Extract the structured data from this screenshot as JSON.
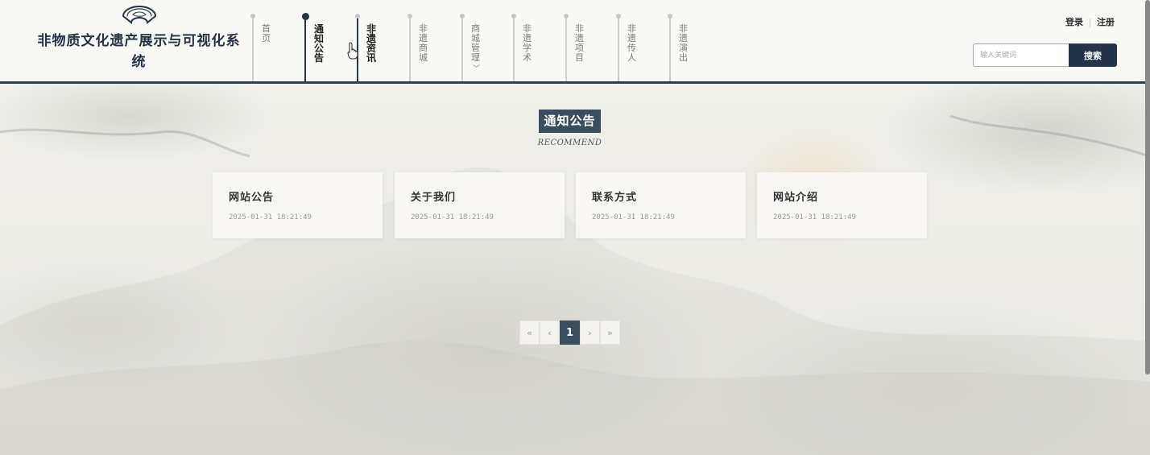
{
  "site": {
    "title": "非物质文化遗产展示与可视化系统"
  },
  "nav": {
    "items": [
      {
        "label": "首页"
      },
      {
        "label": "通知公告"
      },
      {
        "label": "非遗资讯"
      },
      {
        "label": "非遗商城"
      },
      {
        "label": "商城管理"
      },
      {
        "label": "非遗学术"
      },
      {
        "label": "非遗项目"
      },
      {
        "label": "非遗传人"
      },
      {
        "label": "非遗演出"
      }
    ],
    "active": "通知公告"
  },
  "auth": {
    "login": "登录",
    "register": "注册"
  },
  "search": {
    "placeholder": "输入关键词",
    "button": "搜索"
  },
  "section": {
    "title": "通知公告",
    "subtitle": "RECOMMEND"
  },
  "cards": [
    {
      "title": "网站公告",
      "date": "2025-01-31 18:21:49"
    },
    {
      "title": "关于我们",
      "date": "2025-01-31 18:21:49"
    },
    {
      "title": "联系方式",
      "date": "2025-01-31 18:21:49"
    },
    {
      "title": "网站介绍",
      "date": "2025-01-31 18:21:49"
    }
  ],
  "pagination": {
    "first": "«",
    "prev": "‹",
    "current": "1",
    "next": "›",
    "last": "»"
  },
  "colors": {
    "primary": "#253448",
    "accent": "#3c4d5d",
    "background": "#ecebe6"
  }
}
